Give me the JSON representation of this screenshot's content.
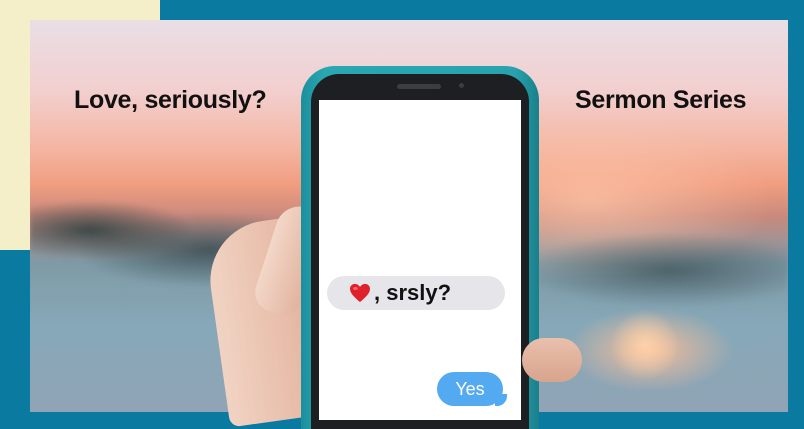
{
  "banner": {
    "title_left": "Love, seriously?",
    "title_right": "Sermon Series"
  },
  "phone": {
    "received_message": ", srsly?",
    "received_icon": "red-heart-icon",
    "sent_message": "Yes"
  },
  "colors": {
    "frame": "#0a7aa0",
    "phone_case": "#27a3ad",
    "sent_bubble": "#54aaf0",
    "received_bubble": "#e6e6ea",
    "heart": "#e0202b"
  }
}
